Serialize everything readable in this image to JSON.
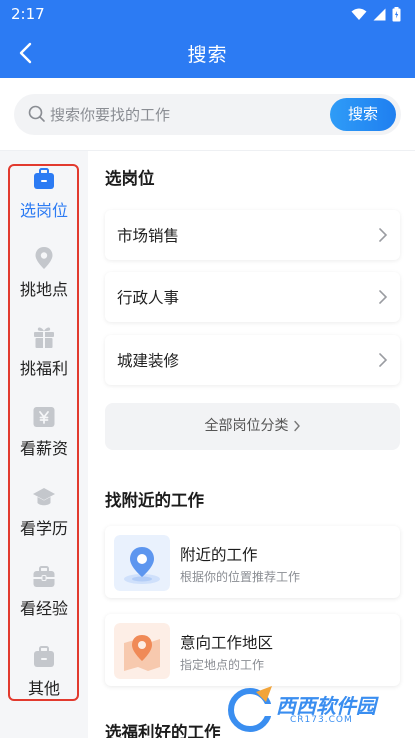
{
  "statusbar": {
    "time": "2:17"
  },
  "header": {
    "title": "搜索"
  },
  "search": {
    "placeholder": "搜索你要找的工作",
    "button_label": "搜索"
  },
  "sidebar": {
    "items": [
      {
        "label": "选岗位",
        "icon": "briefcase-icon",
        "active": true
      },
      {
        "label": "挑地点",
        "icon": "location-pin-icon",
        "active": false
      },
      {
        "label": "挑福利",
        "icon": "gift-icon",
        "active": false
      },
      {
        "label": "看薪资",
        "icon": "yen-icon",
        "active": false
      },
      {
        "label": "看学历",
        "icon": "graduation-cap-icon",
        "active": false
      },
      {
        "label": "看经验",
        "icon": "toolbox-icon",
        "active": false
      },
      {
        "label": "其他",
        "icon": "bag-icon",
        "active": false
      }
    ]
  },
  "main": {
    "positions": {
      "title": "选岗位",
      "items": [
        "市场销售",
        "行政人事",
        "城建装修"
      ],
      "all_label": "全部岗位分类"
    },
    "nearby": {
      "title": "找附近的工作",
      "cards": [
        {
          "title": "附近的工作",
          "subtitle": "根据你的位置推荐工作"
        },
        {
          "title": "意向工作地区",
          "subtitle": "指定地点的工作"
        }
      ]
    },
    "benefits": {
      "title": "选福利好的工作"
    }
  },
  "watermark": {
    "text": "西西软件园",
    "sub": "CR173.COM"
  },
  "colors": {
    "primary": "#2c7bf3",
    "highlight_border": "#e23a2e",
    "icon_gray": "#c4c7cc"
  }
}
